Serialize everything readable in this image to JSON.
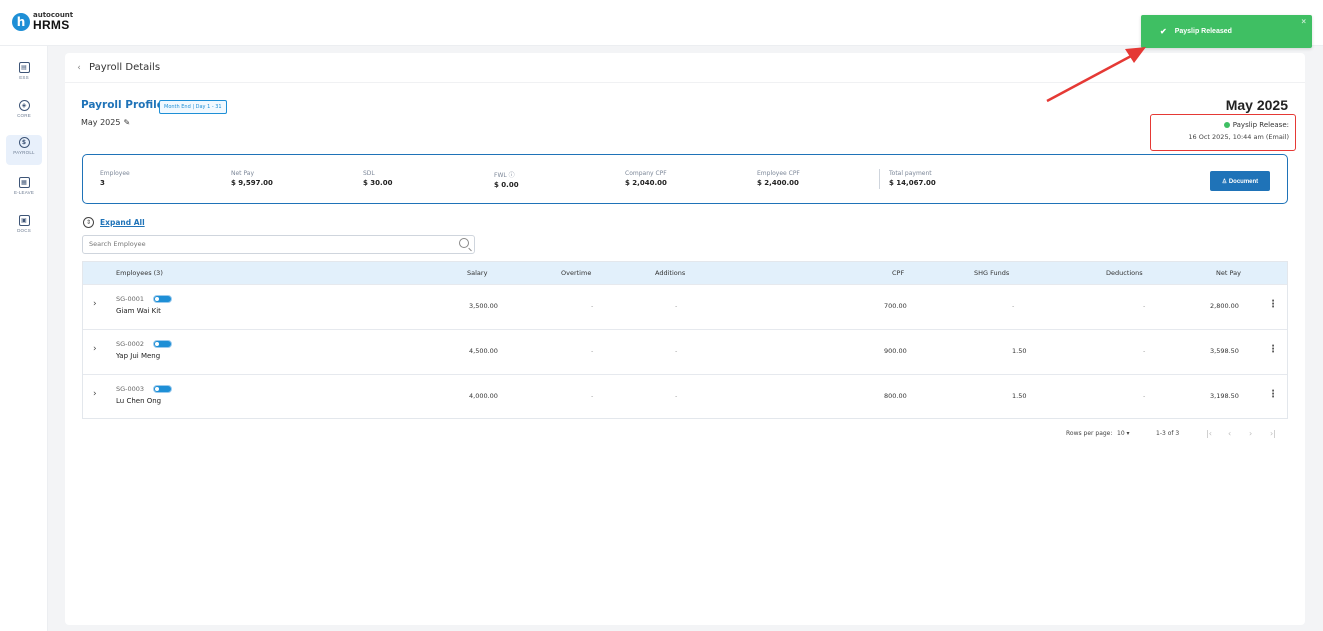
{
  "app": {
    "logo_brand": "autocount",
    "logo_product": "HRMS"
  },
  "toast": {
    "message": "Payslip Released",
    "check_icon": "✔",
    "close_icon": "×"
  },
  "sidebar": {
    "items": [
      {
        "label": "ESS",
        "glyph": "▤"
      },
      {
        "label": "CORE",
        "glyph": "◈"
      },
      {
        "label": "PAYROLL",
        "glyph": "$"
      },
      {
        "label": "E-LEAVE",
        "glyph": "▦"
      },
      {
        "label": "DOCS",
        "glyph": "▣"
      }
    ]
  },
  "page": {
    "title": "Payroll Details",
    "back_glyph": "‹"
  },
  "profile": {
    "title": "Payroll Profile",
    "badge": "Month End | Day 1 - 31",
    "period": "May 2025",
    "edit_glyph": "✎",
    "month_heading": "May 2025",
    "release_label": "Payslip Release:",
    "release_detail": "16 Oct 2025, 10:44 am (Email)"
  },
  "summary": {
    "employee_label": "Employee",
    "employee_value": "3",
    "netpay_label": "Net Pay",
    "netpay_value": "$ 9,597.00",
    "sdl_label": "SDL",
    "sdl_value": "$ 30.00",
    "fwl_label": "FWL ⓘ",
    "fwl_value": "$ 0.00",
    "company_cpf_label": "Company CPF",
    "company_cpf_value": "$ 2,040.00",
    "employee_cpf_label": "Employee CPF",
    "employee_cpf_value": "$ 2,400.00",
    "total_label": "Total payment",
    "total_value": "$ 14,067.00",
    "document_button": "♙ Document"
  },
  "controls": {
    "expand_label": "Expand All",
    "expand_glyph": "⇕",
    "search_placeholder": "Search Employee"
  },
  "table": {
    "headers": {
      "employees": "Employees (3)",
      "salary": "Salary",
      "overtime": "Overtime",
      "additions": "Additions",
      "cpf": "CPF",
      "shg": "SHG Funds",
      "deductions": "Deductions",
      "netpay": "Net Pay"
    },
    "rows": [
      {
        "code": "SG-0001",
        "name": "Giam Wai Kit",
        "salary": "3,500.00",
        "overtime": "-",
        "additions": "-",
        "cpf": "700.00",
        "shg": "-",
        "deductions": "-",
        "netpay": "2,800.00"
      },
      {
        "code": "SG-0002",
        "name": "Yap Jui Meng",
        "salary": "4,500.00",
        "overtime": "-",
        "additions": "-",
        "cpf": "900.00",
        "shg": "1.50",
        "deductions": "-",
        "netpay": "3,598.50"
      },
      {
        "code": "SG-0003",
        "name": "Lu Chen Ong",
        "salary": "4,000.00",
        "overtime": "-",
        "additions": "-",
        "cpf": "800.00",
        "shg": "1.50",
        "deductions": "-",
        "netpay": "3,198.50"
      }
    ],
    "chev_glyph": "›",
    "kebab_glyph": "⋮"
  },
  "pagination": {
    "rows_label": "Rows per page:",
    "rows_value": "10 ▾",
    "range": "1-3 of 3",
    "first": "|‹",
    "prev": "‹",
    "next": "›",
    "last": "›|"
  },
  "colors": {
    "accent": "#1f73b8",
    "success": "#3fbf63",
    "highlight": "#e53935",
    "header_bg": "#e2f0fb"
  }
}
